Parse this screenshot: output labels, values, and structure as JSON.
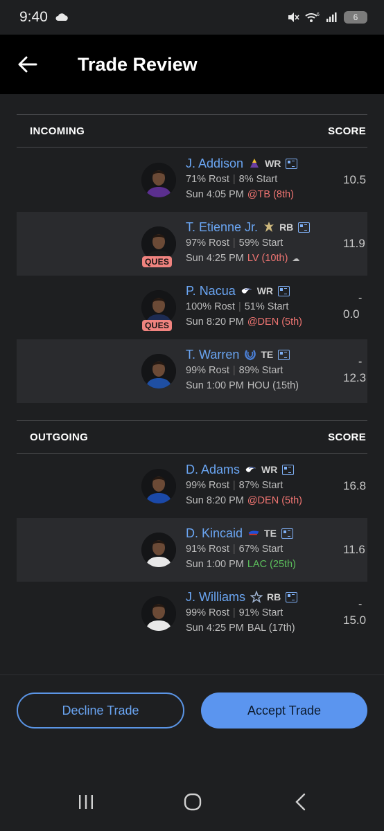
{
  "status_bar": {
    "time": "9:40",
    "battery": "6"
  },
  "header": {
    "title": "Trade Review"
  },
  "incoming": {
    "label": "INCOMING",
    "score_label": "SCORE",
    "players": [
      {
        "name": "J. Addison",
        "position": "WR",
        "team_logo": "vikings-logo",
        "rost": "71% Rost",
        "start": "8% Start",
        "game": "Sun 4:05 PM",
        "opponent": "@TB (8th)",
        "opponent_color": "red",
        "status": "",
        "score_dash": "",
        "score": "10.5",
        "jersey": "#5b2f8f"
      },
      {
        "name": "T. Etienne Jr.",
        "position": "RB",
        "team_logo": "saints-logo",
        "rost": "97% Rost",
        "start": "59% Start",
        "game": "Sun 4:25 PM",
        "opponent": "LV (10th)",
        "opponent_color": "red",
        "status": "QUES",
        "score_dash": "",
        "score": "11.9",
        "jersey": "#1a1a1a"
      },
      {
        "name": "P. Nacua",
        "position": "WR",
        "team_logo": "rams-logo",
        "rost": "100% Rost",
        "start": "51% Start",
        "game": "Sun 8:20 PM",
        "opponent": "@DEN (5th)",
        "opponent_color": "red",
        "status": "QUES",
        "score_dash": "-",
        "score": "0.0",
        "jersey": "#1d2b52"
      },
      {
        "name": "T. Warren",
        "position": "TE",
        "team_logo": "colts-logo",
        "rost": "99% Rost",
        "start": "89% Start",
        "game": "Sun 1:00 PM",
        "opponent": "HOU (15th)",
        "opponent_color": "plain",
        "status": "",
        "score_dash": "-",
        "score": "12.3",
        "jersey": "#1f4fa3"
      }
    ]
  },
  "outgoing": {
    "label": "OUTGOING",
    "score_label": "SCORE",
    "players": [
      {
        "name": "D. Adams",
        "position": "WR",
        "team_logo": "rams-logo",
        "rost": "99% Rost",
        "start": "87% Start",
        "game": "Sun 8:20 PM",
        "opponent": "@DEN (5th)",
        "opponent_color": "red",
        "status": "",
        "score_dash": "",
        "score": "16.8",
        "jersey": "#1b49a8"
      },
      {
        "name": "D. Kincaid",
        "position": "TE",
        "team_logo": "bills-logo",
        "rost": "91% Rost",
        "start": "67% Start",
        "game": "Sun 1:00 PM",
        "opponent": "LAC (25th)",
        "opponent_color": "green",
        "status": "",
        "score_dash": "",
        "score": "11.6",
        "jersey": "#e8e8e8"
      },
      {
        "name": "J. Williams",
        "position": "RB",
        "team_logo": "cowboys-logo",
        "rost": "99% Rost",
        "start": "91% Start",
        "game": "Sun 4:25 PM",
        "opponent": "BAL (17th)",
        "opponent_color": "plain",
        "status": "",
        "score_dash": "-",
        "score": "15.0",
        "jersey": "#e8e8e8"
      }
    ]
  },
  "actions": {
    "decline": "Decline Trade",
    "accept": "Accept Trade"
  },
  "colors": {
    "accent": "#6aa5f2",
    "questionable": "#f0837f",
    "bad_matchup": "#f07572",
    "good_matchup": "#5cc05c"
  }
}
